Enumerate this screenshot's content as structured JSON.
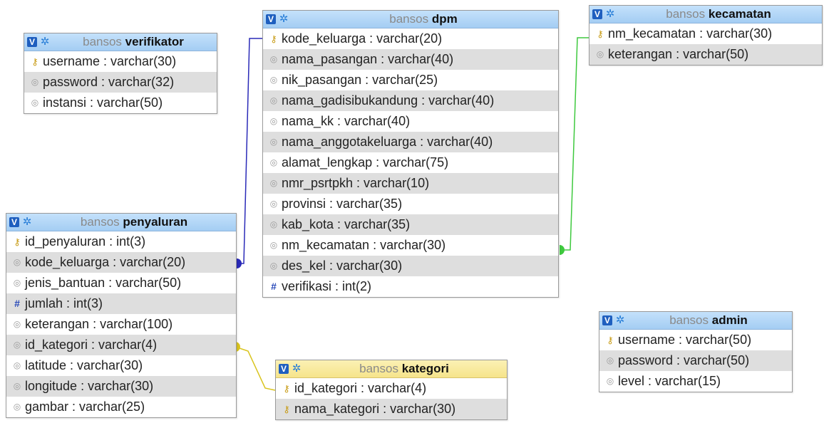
{
  "db_prefix": "bansos",
  "tables": {
    "verifikator": {
      "name": "verifikator",
      "columns": [
        {
          "text": "username : varchar(30)",
          "icon": "key-icon"
        },
        {
          "text": "password : varchar(32)",
          "icon": "column-icon"
        },
        {
          "text": "instansi : varchar(50)",
          "icon": "column-icon"
        }
      ]
    },
    "dpm": {
      "name": "dpm",
      "columns": [
        {
          "text": "kode_keluarga : varchar(20)",
          "icon": "key-icon"
        },
        {
          "text": "nama_pasangan : varchar(40)",
          "icon": "column-icon"
        },
        {
          "text": "nik_pasangan : varchar(25)",
          "icon": "column-icon"
        },
        {
          "text": "nama_gadisibukandung : varchar(40)",
          "icon": "column-icon"
        },
        {
          "text": "nama_kk : varchar(40)",
          "icon": "column-icon"
        },
        {
          "text": "nama_anggotakeluarga : varchar(40)",
          "icon": "column-icon"
        },
        {
          "text": "alamat_lengkap : varchar(75)",
          "icon": "column-icon"
        },
        {
          "text": "nmr_psrtpkh : varchar(10)",
          "icon": "column-icon"
        },
        {
          "text": "provinsi : varchar(35)",
          "icon": "column-icon"
        },
        {
          "text": "kab_kota : varchar(35)",
          "icon": "column-icon"
        },
        {
          "text": "nm_kecamatan : varchar(30)",
          "icon": "column-icon"
        },
        {
          "text": "des_kel : varchar(30)",
          "icon": "column-icon"
        },
        {
          "text": "verifikasi : int(2)",
          "icon": "numeric-icon"
        }
      ]
    },
    "kecamatan": {
      "name": "kecamatan",
      "columns": [
        {
          "text": "nm_kecamatan : varchar(30)",
          "icon": "key-icon"
        },
        {
          "text": "keterangan : varchar(50)",
          "icon": "column-icon"
        }
      ]
    },
    "penyaluran": {
      "name": "penyaluran",
      "columns": [
        {
          "text": "id_penyaluran : int(3)",
          "icon": "key-icon"
        },
        {
          "text": "kode_keluarga : varchar(20)",
          "icon": "column-icon"
        },
        {
          "text": "jenis_bantuan : varchar(50)",
          "icon": "column-icon"
        },
        {
          "text": "jumlah : int(3)",
          "icon": "numeric-icon"
        },
        {
          "text": "keterangan : varchar(100)",
          "icon": "column-icon"
        },
        {
          "text": "id_kategori : varchar(4)",
          "icon": "column-icon"
        },
        {
          "text": "latitude : varchar(30)",
          "icon": "column-icon"
        },
        {
          "text": "longitude : varchar(30)",
          "icon": "column-icon"
        },
        {
          "text": "gambar : varchar(25)",
          "icon": "column-icon"
        }
      ]
    },
    "kategori": {
      "name": "kategori",
      "columns": [
        {
          "text": "id_kategori : varchar(4)",
          "icon": "key-icon"
        },
        {
          "text": "nama_kategori : varchar(30)",
          "icon": "key-icon"
        }
      ]
    },
    "admin": {
      "name": "admin",
      "columns": [
        {
          "text": "username : varchar(50)",
          "icon": "key-icon"
        },
        {
          "text": "password : varchar(50)",
          "icon": "column-icon"
        },
        {
          "text": "level : varchar(15)",
          "icon": "column-icon"
        }
      ]
    }
  },
  "relations": [
    {
      "from": "penyaluran.kode_keluarga",
      "to": "dpm.kode_keluarga",
      "color": "#2a2ab8"
    },
    {
      "from": "dpm.nm_kecamatan",
      "to": "kecamatan.nm_kecamatan",
      "color": "#3ec93e"
    },
    {
      "from": "penyaluran.id_kategori",
      "to": "kategori.id_kategori",
      "color": "#d9c41f"
    }
  ]
}
